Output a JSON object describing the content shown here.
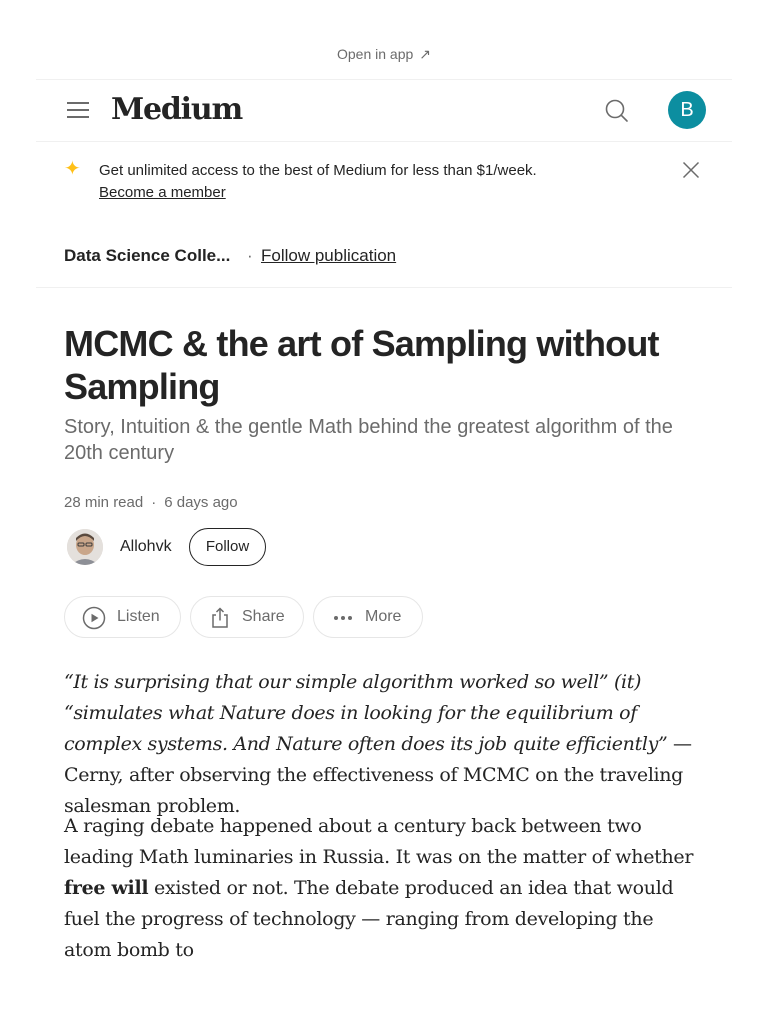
{
  "banner": {
    "open_in_app": "Open in app",
    "arrow_icon": "arrow-up-right-icon"
  },
  "header": {
    "logo": "Medium",
    "menu_icon": "hamburger-icon",
    "search_icon": "search-icon",
    "avatar_initial": "B",
    "avatar_color": "#0c8ea0"
  },
  "promo": {
    "text": "Get unlimited access to the best of Medium for less than $1/week.",
    "link": "Become a member",
    "sparkle_color": "#ffc017"
  },
  "publication": {
    "name": "Data Science Colle...",
    "separator": "·",
    "follow_label": "Follow publication"
  },
  "article": {
    "title": "MCMC & the art of Sampling without Sampling",
    "subtitle": "Story, Intuition & the gentle Math behind the greatest algorithm of the 20th century",
    "read_time": "28 min read",
    "separator": "·",
    "published": "6 days ago",
    "author": {
      "name": "Allohvk",
      "follow_label": "Follow"
    },
    "actions": {
      "listen": "Listen",
      "share": "Share",
      "more": "More"
    },
    "paragraph1": {
      "quote": "“It is surprising that our simple algorithm worked so well” (it) “simulates what Nature does in looking for the equilibrium of complex systems. And Nature often does its job quite efficiently”",
      "rest": " — Cerny, after observing the effectiveness of MCMC on the traveling salesman problem."
    },
    "paragraph2": {
      "part1": "A raging debate happened about a century back between two leading Math luminaries in Russia. It was on the matter of whether ",
      "bold": "free will",
      "part2": " existed or not. The debate produced an idea that would fuel the progress of technology — ranging from developing the atom bomb to"
    }
  }
}
